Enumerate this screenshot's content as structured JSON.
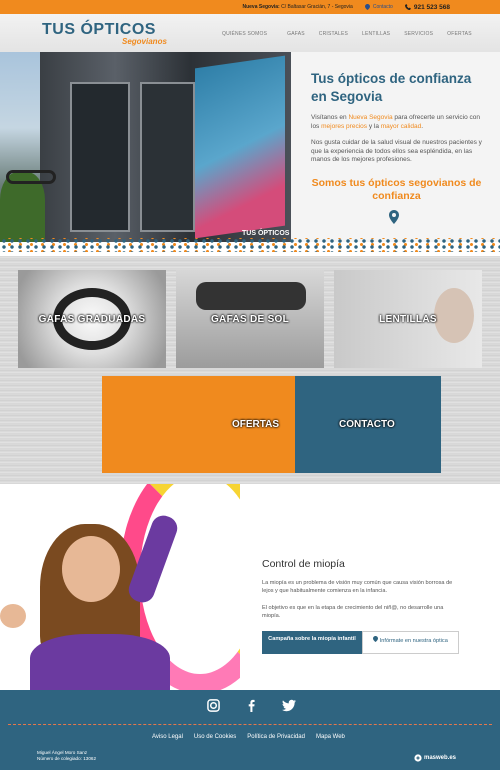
{
  "topbar": {
    "address_bold": "Nueva Segovia:",
    "address": "C/ Baltasar Gracián, 7 - Segovia",
    "contact_label": "Contacto",
    "phone": "921 523 568"
  },
  "logo": {
    "line1": "TUS ÓPTICOS",
    "line2": "Segovianos"
  },
  "nav": [
    "QUIÉNES SOMOS",
    "GAFAS",
    "CRISTALES",
    "LENTILLAS",
    "SERVICIOS",
    "OFERTAS"
  ],
  "hero": {
    "image_caption": "TUS ÓPTICOS",
    "title": "Tus ópticos de confianza en Segovia",
    "p1_a": "Visítanos en ",
    "p1_b": "Nueva Segovia",
    "p1_c": " para ofrecerte un servicio con los ",
    "p1_d": "mejores precios",
    "p1_e": " y la ",
    "p1_f": "mayor calidad",
    "p1_g": ".",
    "p2": "Nos gusta cuidar de la salud visual de nuestros pacientes y que la experiencia de todos ellos sea espléndida, en las manos de los mejores profesiones.",
    "subtitle": "Somos tus ópticos segovianos de confianza"
  },
  "categories": [
    {
      "label": "GAFAS GRADUADAS"
    },
    {
      "label": "GAFAS DE SOL"
    },
    {
      "label": "LENTILLAS"
    }
  ],
  "big_tiles": [
    {
      "label": "OFERTAS",
      "color": "#f08a1e"
    },
    {
      "label": "CONTACTO",
      "color": "#2f6480"
    }
  ],
  "myopia": {
    "title": "Control de miopía",
    "p1": "La miopía es un problema de visión muy común que causa visión borrosa de lejos y que habitualmente comienza en la infancia.",
    "p2": "El objetivo es que en la etapa de crecimiento del niñ@, no desarrolle una miopía.",
    "btn1": "Campaña sobre la miopía infantil",
    "btn2": "Infórmate en nuestra óptica"
  },
  "footer": {
    "links": [
      "Aviso Legal",
      "Uso de Cookies",
      "Política de Privacidad",
      "Mapa Web"
    ],
    "owner_name": "Miguel Ángel Moro Sanz",
    "owner_id": "Número de colegiado: 13062",
    "credit": "masweb.es"
  },
  "colors": {
    "brand_blue": "#2f6480",
    "brand_orange": "#f08a1e"
  }
}
